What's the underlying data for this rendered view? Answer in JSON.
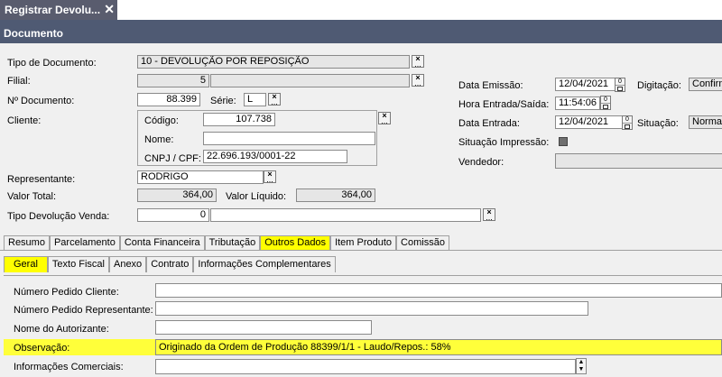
{
  "window": {
    "tab_title": "Registrar Devolu...",
    "header": "Documento"
  },
  "form": {
    "tipo_documento": {
      "label": "Tipo de Documento:",
      "value": "10 - DEVOLUÇÃO POR REPOSIÇÃO"
    },
    "filial": {
      "label": "Filial:",
      "value": "5"
    },
    "numero_documento": {
      "label": "Nº Documento:",
      "value": "88.399"
    },
    "serie": {
      "label": "Série:",
      "value": "L"
    },
    "cliente": {
      "label": "Cliente:",
      "codigo_label": "Código:",
      "codigo": "107.738",
      "nome_label": "Nome:",
      "nome": "",
      "cnpj_label": "CNPJ / CPF:",
      "cnpj": "22.696.193/0001-22"
    },
    "representante": {
      "label": "Representante:",
      "value": "RODRIGO"
    },
    "valor_total": {
      "label": "Valor Total:",
      "value": "364,00"
    },
    "valor_liquido": {
      "label": "Valor Líquido:",
      "value": "364,00"
    },
    "tipo_devolucao": {
      "label": "Tipo Devolução Venda:",
      "value": "0",
      "desc": ""
    },
    "data_emissao": {
      "label": "Data Emissão:",
      "value": "12/04/2021"
    },
    "digitacao": {
      "label": "Digitação:",
      "value": "Confirm"
    },
    "hora": {
      "label": "Hora Entrada/Saída:",
      "value": "11:54:06"
    },
    "data_entrada": {
      "label": "Data Entrada:",
      "value": "12/04/2021"
    },
    "situacao": {
      "label": "Situação:",
      "value": "Normal"
    },
    "situacao_impressao": {
      "label": "Situação Impressão:"
    },
    "vendedor": {
      "label": "Vendedor:",
      "value": ""
    }
  },
  "tabs": [
    "Resumo",
    "Parcelamento",
    "Conta Financeira",
    "Tributação",
    "Outros Dados",
    "Item Produto",
    "Comissão"
  ],
  "subtabs": [
    "Geral",
    "Texto Fiscal",
    "Anexo",
    "Contrato",
    "Informações Complementares"
  ],
  "geral": {
    "pedido_cliente": {
      "label": "Número Pedido Cliente:",
      "value": ""
    },
    "pedido_representante": {
      "label": "Número Pedido Representante:",
      "value": ""
    },
    "autorizante": {
      "label": "Nome do Autorizante:",
      "value": ""
    },
    "observacao": {
      "label": "Observação:",
      "value": "Originado da Ordem de Produção 88399/1/1 - Laudo/Repos.: 58%"
    },
    "info_comerciais": {
      "label": "Informações Comerciais:",
      "value": ""
    }
  },
  "colors": {
    "header_bg": "#4f5a73",
    "tab_bg": "#595c6e",
    "highlight": "#ffff00"
  },
  "icons": {
    "lookup": "ellipsis-x-button",
    "calendar": "calendar-icon",
    "close": "close-icon"
  }
}
